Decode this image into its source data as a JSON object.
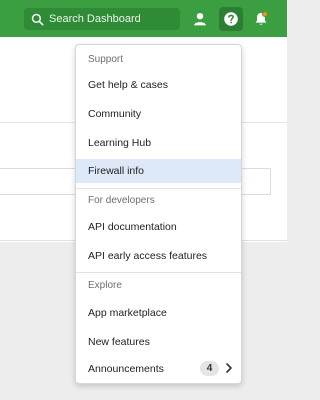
{
  "header": {
    "search_placeholder": "Search Dashboard",
    "icons": [
      "search-icon",
      "user-icon",
      "help-icon",
      "bell-icon"
    ]
  },
  "menu": {
    "sections": [
      {
        "label": "Support",
        "items": [
          "Get help & cases",
          "Community",
          "Learning Hub",
          "Firewall info"
        ]
      },
      {
        "label": "For developers",
        "items": [
          "API documentation",
          "API early access features"
        ]
      },
      {
        "label": "Explore",
        "items": [
          "App marketplace",
          "New features",
          "Announcements"
        ]
      }
    ],
    "active_item": "Firewall info",
    "announcements_count": "4"
  },
  "colors": {
    "header_green": "#3b9e41",
    "active_highlight": "#dde8f8",
    "notification_dot": "#ff8a1f"
  }
}
